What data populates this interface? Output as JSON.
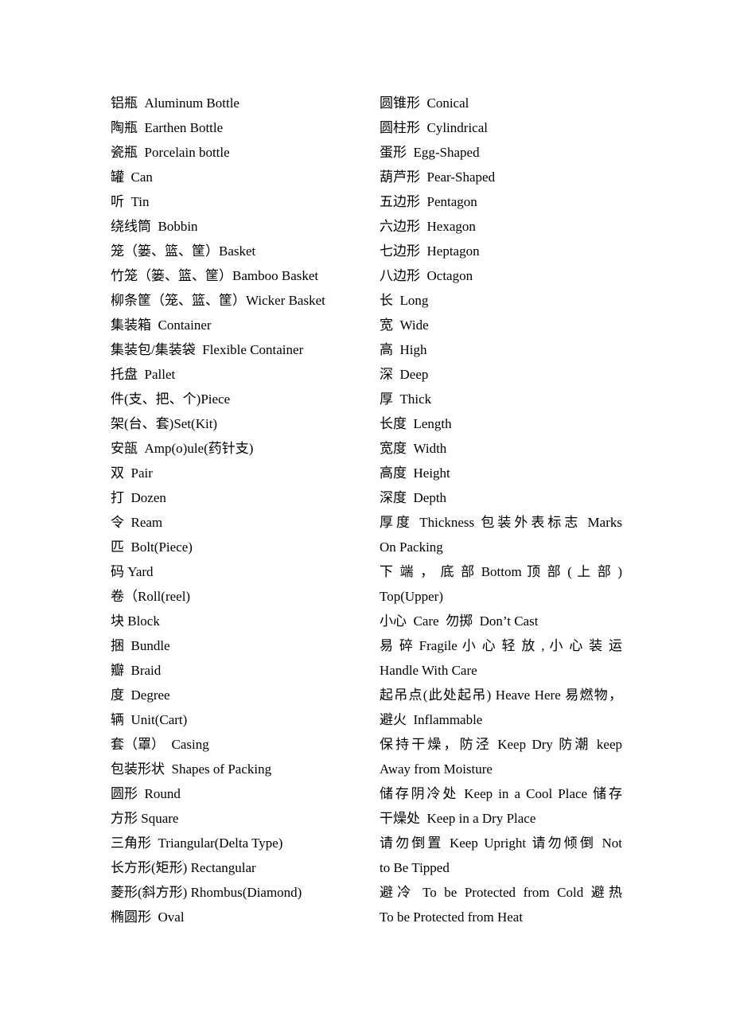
{
  "left_column": [
    "铝瓶  Aluminum Bottle",
    "陶瓶  Earthen Bottle",
    "瓷瓶  Porcelain bottle",
    "罐  Can",
    "听  Tin",
    "绕线筒  Bobbin",
    "笼（篓、篮、筐）Basket",
    "竹笼（篓、篮、筐）Bamboo Basket",
    "柳条筐（笼、篮、筐）Wicker Basket",
    "集装箱  Container",
    "集装包/集装袋  Flexible Container",
    "托盘  Pallet",
    "件(支、把、个)Piece",
    "架(台、套)Set(Kit)",
    "安瓿  Amp(o)ule(药针支)",
    "双  Pair",
    "打  Dozen",
    "令  Ream",
    "匹  Bolt(Piece)",
    "码 Yard",
    "卷（Roll(reel)",
    "块 Block",
    "捆  Bundle",
    "瓣  Braid",
    "度  Degree",
    "辆  Unit(Cart)",
    "套（罩）  Casing",
    "包装形状  Shapes of Packing",
    "圆形  Round",
    "方形 Square",
    "三角形  Triangular(Delta Type)",
    "长方形(矩形) Rectangular",
    "菱形(斜方形) Rhombus(Diamond)",
    "椭圆形  Oval"
  ],
  "right_column": [
    {
      "text": "圆锥形  Conical",
      "justify": false
    },
    {
      "text": "圆柱形  Cylindrical",
      "justify": false
    },
    {
      "text": "蛋形  Egg-Shaped",
      "justify": false
    },
    {
      "text": "葫芦形  Pear-Shaped",
      "justify": false
    },
    {
      "text": "五边形  Pentagon",
      "justify": false
    },
    {
      "text": "六边形  Hexagon",
      "justify": false
    },
    {
      "text": "七边形  Heptagon",
      "justify": false
    },
    {
      "text": "八边形  Octagon",
      "justify": false
    },
    {
      "text": "长  Long",
      "justify": false
    },
    {
      "text": "宽  Wide",
      "justify": false
    },
    {
      "text": "高  High",
      "justify": false
    },
    {
      "text": "深  Deep",
      "justify": false
    },
    {
      "text": "厚  Thick",
      "justify": false
    },
    {
      "text": "长度  Length",
      "justify": false
    },
    {
      "text": "宽度  Width",
      "justify": false
    },
    {
      "text": "高度  Height",
      "justify": false
    },
    {
      "text": "深度  Depth",
      "justify": false
    },
    {
      "text": "厚度  Thickness  包装外表标志  Marks",
      "justify": true
    },
    {
      "text": "On Packing",
      "justify": false
    },
    {
      "text": "下 端 ， 底 部   Bottom  顶 部 ( 上 部 )",
      "justify": true
    },
    {
      "text": "Top(Upper)",
      "justify": false
    },
    {
      "text": "小心  Care  勿掷  Don’t Cast",
      "justify": false
    },
    {
      "text": "易 碎   Fragile  小 心 轻 放 , 小 心 装 运",
      "justify": true
    },
    {
      "text": "Handle With Care",
      "justify": false
    },
    {
      "text": "起吊点(此处起吊) Heave Here  易燃物，",
      "justify": true
    },
    {
      "text": "避火  Inflammable",
      "justify": false
    },
    {
      "text": "保持干燥，防泾  Keep Dry  防潮  keep",
      "justify": true
    },
    {
      "text": "Away from Moisture",
      "justify": false
    },
    {
      "text": "储存阴冷处  Keep in a Cool Place  储存",
      "justify": true
    },
    {
      "text": "干燥处  Keep in a Dry Place",
      "justify": false
    },
    {
      "text": "请勿倒置  Keep Upright  请勿倾倒  Not",
      "justify": true
    },
    {
      "text": "to Be Tipped",
      "justify": false
    },
    {
      "text": "避冷   To be Protected from Cold  避热",
      "justify": true
    },
    {
      "text": "To be Protected from Heat",
      "justify": false
    }
  ]
}
